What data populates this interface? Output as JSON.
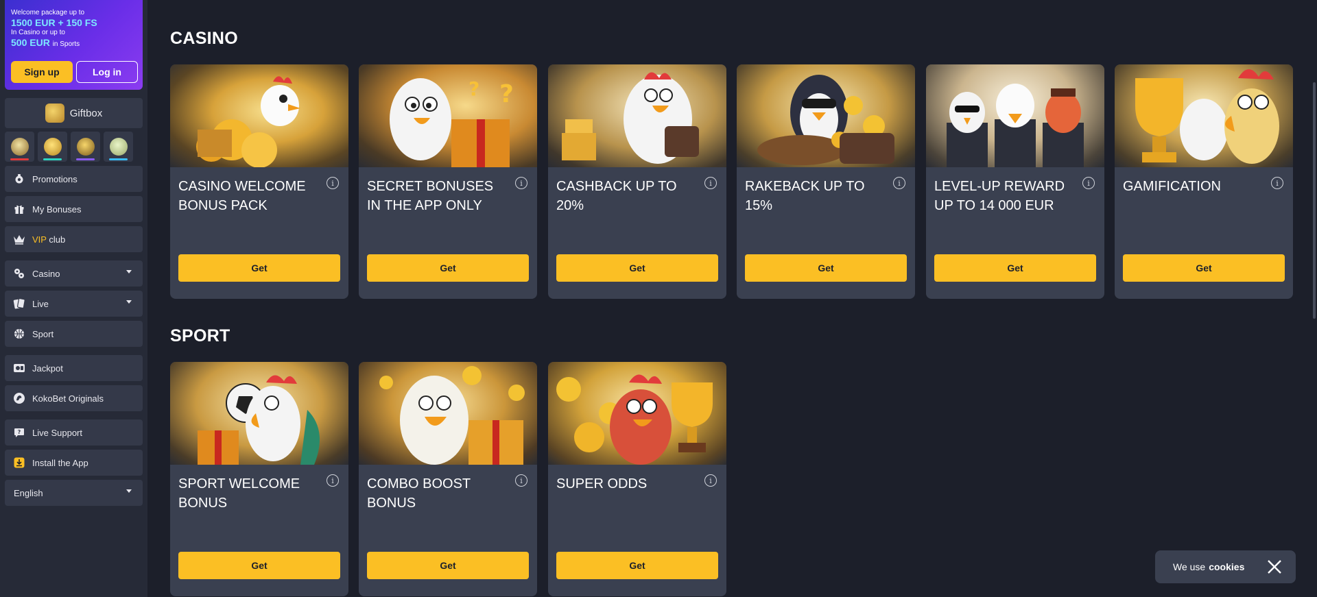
{
  "sidebar": {
    "promo": {
      "line1": "Welcome package up to",
      "amount1": "1500 EUR + 150 FS",
      "line2": "In Casino or up to",
      "amount2": "500 EUR",
      "amount2_suffix": "in Sports",
      "signup_label": "Sign up",
      "login_label": "Log in"
    },
    "giftbox_label": "Giftbox",
    "nav": {
      "promotions": "Promotions",
      "my_bonuses": "My Bonuses",
      "vip": "VIP",
      "club": "club",
      "casino": "Casino",
      "live": "Live",
      "sport": "Sport",
      "jackpot": "Jackpot",
      "originals": "KokoBet Originals",
      "live_support": "Live Support",
      "install_app": "Install the App",
      "language": "English"
    }
  },
  "sections": {
    "casino_title": "CASINO",
    "sport_title": "SPORT"
  },
  "casino_cards": [
    {
      "title": "Casino welcome bonus pack",
      "button": "Get"
    },
    {
      "title": "Secret bonuses in the app only",
      "button": "Get"
    },
    {
      "title": "Cashback up to 20%",
      "button": "Get"
    },
    {
      "title": "Rakeback up to 15%",
      "button": "Get"
    },
    {
      "title": "Level-up reward up to 14 000 EUR",
      "button": "Get"
    },
    {
      "title": "Gamification",
      "button": "Get"
    }
  ],
  "sport_cards": [
    {
      "title": "Sport welcome bonus",
      "button": "Get"
    },
    {
      "title": "Combo boost bonus",
      "button": "Get"
    },
    {
      "title": "Super odds",
      "button": "Get"
    }
  ],
  "info_glyph": "i",
  "cookie": {
    "text": "We use",
    "bold": "cookies"
  },
  "colors": {
    "accent": "#fbbf24",
    "card_bg": "#3a4050",
    "page_bg": "#1c1f2a",
    "sidebar_bg": "#262a37"
  }
}
